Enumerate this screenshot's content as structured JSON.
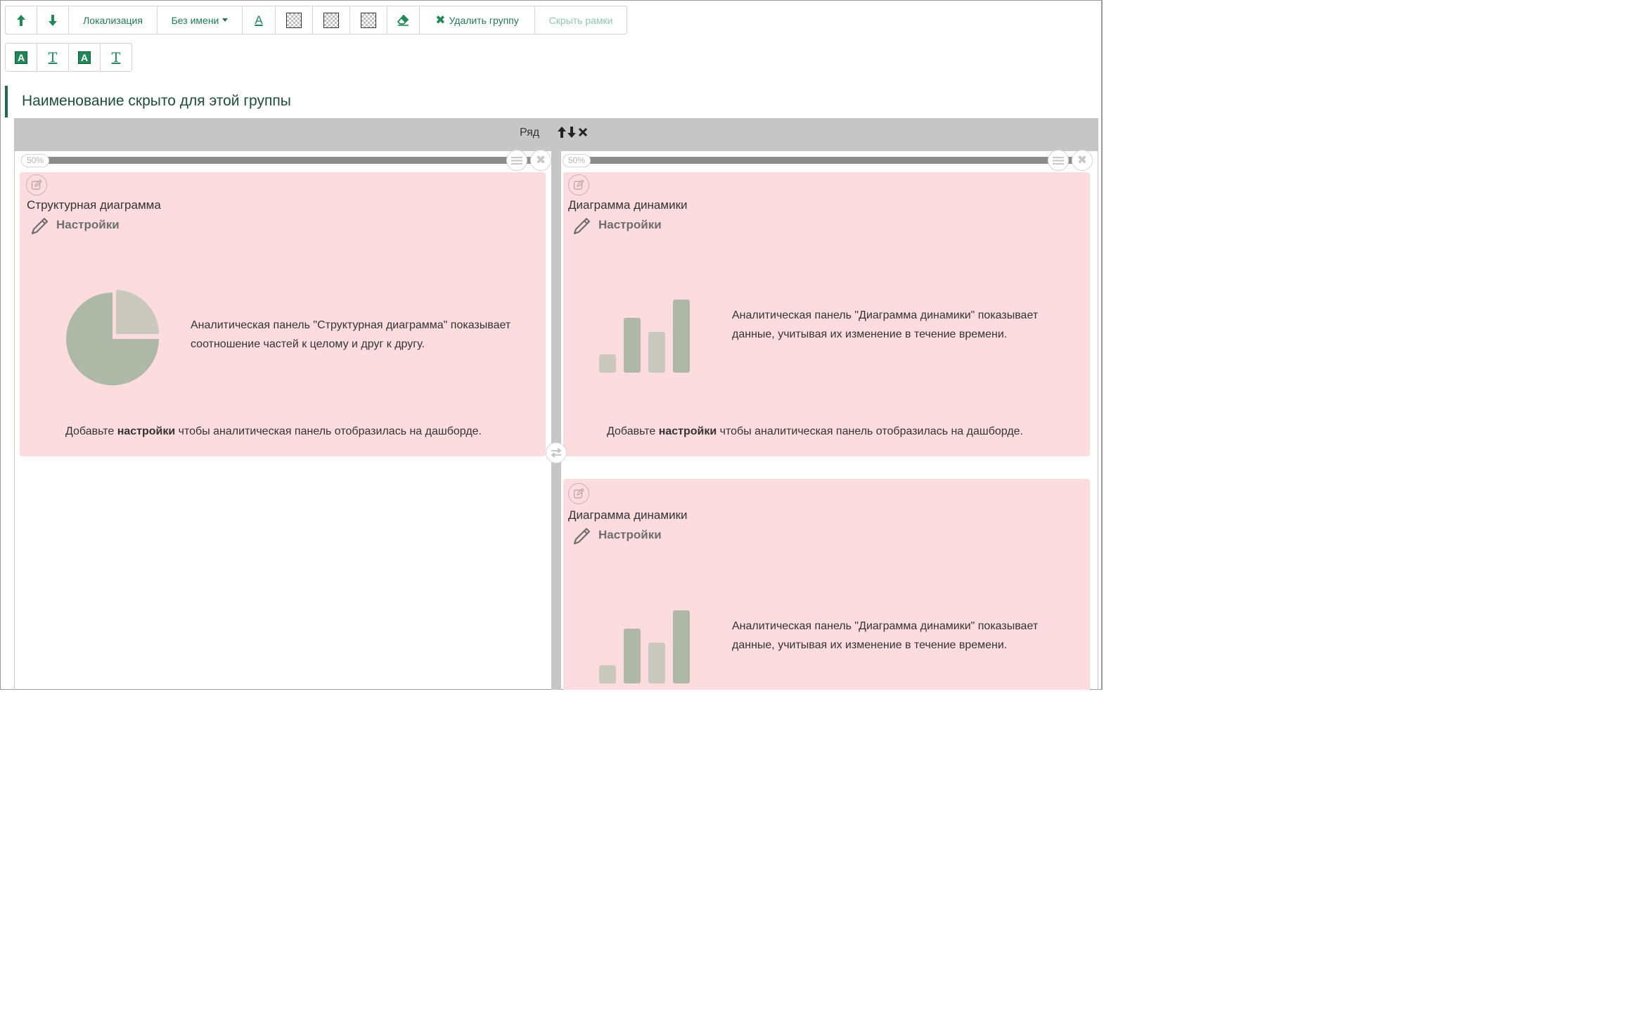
{
  "toolbar_top": {
    "move_up_icon": "arrow-up-icon",
    "move_down_icon": "arrow-down-icon",
    "localization_label": "Локализация",
    "name_select_label": "Без имени",
    "text_color_glyph": "A",
    "delete_group_label": "Удалить группу",
    "hide_frames_label": "Скрыть рамки"
  },
  "toolbar_second": {
    "title_bg_glyph": "A",
    "title_text_glyph": "T",
    "text_bg_glyph": "A",
    "text_glyph": "T"
  },
  "group": {
    "title": "Наименование скрыто для этой группы"
  },
  "row": {
    "label": "Ряд",
    "controls": "🡅🡇✖"
  },
  "columns": [
    {
      "width_label": "50%"
    },
    {
      "width_label": "50%"
    }
  ],
  "panels": [
    {
      "title": "Структурная диаграмма",
      "settings_label": "Настройки",
      "description": "Аналитическая панель \"Структурная диаграмма\" показывает соотношение частей к целому и друг к другу.",
      "hint_before": "Добавьте ",
      "hint_bold": "настройки",
      "hint_after": " чтобы аналитическая панель отобразилась на дашборде."
    },
    {
      "title": "Диаграмма динамики",
      "settings_label": "Настройки",
      "description": "Аналитическая панель \"Диаграмма динамики\" показывает данные, учитывая их изменение в течение времени.",
      "hint_before": "Добавьте ",
      "hint_bold": "настройки",
      "hint_after": " чтобы аналитическая панель отобразилась на дашборде."
    },
    {
      "title": "Диаграмма динамики",
      "settings_label": "Настройки",
      "description": "Аналитическая панель \"Диаграмма динамики\" показывает данные, учитывая их изменение в течение времени."
    }
  ],
  "colors": {
    "accent_green": "#1f8a57",
    "panel_bg": "#fcdcdf",
    "illustration_dark": "#aeb8a6",
    "illustration_light": "#c9cabd",
    "frame_gray": "#c6c6c6"
  }
}
